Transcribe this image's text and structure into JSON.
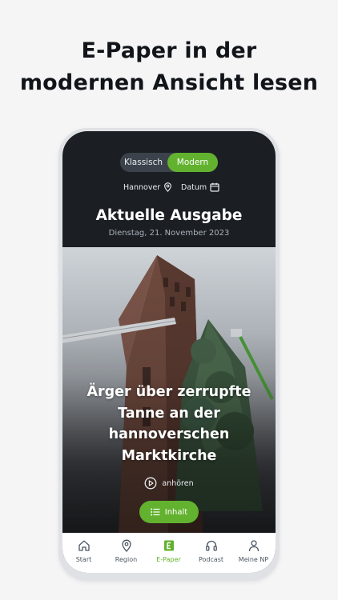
{
  "promo": {
    "line1": "E-Paper in der",
    "line2": "modernen Ansicht lesen"
  },
  "toggle": {
    "left_label": "Klassisch",
    "right_label": "Modern",
    "selected": "Modern"
  },
  "filters": {
    "region_label": "Hannover",
    "region_icon": "map-pin-icon",
    "date_label": "Datum",
    "date_icon": "calendar-icon"
  },
  "issue": {
    "title": "Aktuelle Ausgabe",
    "date": "Dienstag, 21. November 2023"
  },
  "cover": {
    "headline": "Ärger über zerrupfte Tanne an der hannoverschen Marktkirche",
    "listen_label": "anhören",
    "listen_icon": "play-circle-icon",
    "contents_label": "Inhalt",
    "contents_icon": "list-icon"
  },
  "tabs": [
    {
      "label": "Start",
      "icon": "home-icon"
    },
    {
      "label": "Region",
      "icon": "map-pin-icon"
    },
    {
      "label": "E-Paper",
      "icon": "epaper-icon"
    },
    {
      "label": "Podcast",
      "icon": "headphones-icon"
    },
    {
      "label": "Meine NP",
      "icon": "user-icon"
    }
  ],
  "active_tab": "E-Paper",
  "colors": {
    "accent": "#62b22f",
    "dark": "#1b1f24",
    "background": "#f5f5f6"
  }
}
